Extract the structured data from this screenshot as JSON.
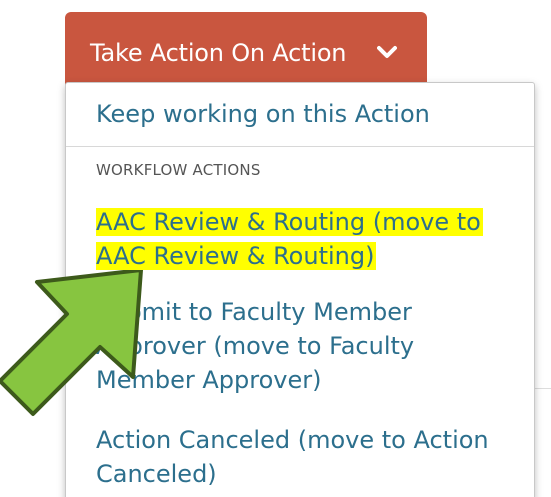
{
  "action_button": {
    "label": "Take Action On Action",
    "icon": "chevron-down-icon"
  },
  "dropdown": {
    "keep_working_label": "Keep working on this Action",
    "section_header": "WORKFLOW ACTIONS",
    "items": [
      {
        "label": "AAC Review & Routing (move to AAC Review & Routing)",
        "highlighted": true
      },
      {
        "label": "Submit to Faculty Member Approver (move to Faculty Member Approver)",
        "highlighted": false
      },
      {
        "label": "Action Canceled (move to Action Canceled)",
        "highlighted": false
      }
    ]
  },
  "annotation": {
    "icon": "green-arrow-icon",
    "fill": "#87c540",
    "stroke": "#3d5a1b"
  },
  "colors": {
    "button": "#c9563f",
    "menu_link": "#2c6f8d",
    "highlight": "#ffff00"
  }
}
